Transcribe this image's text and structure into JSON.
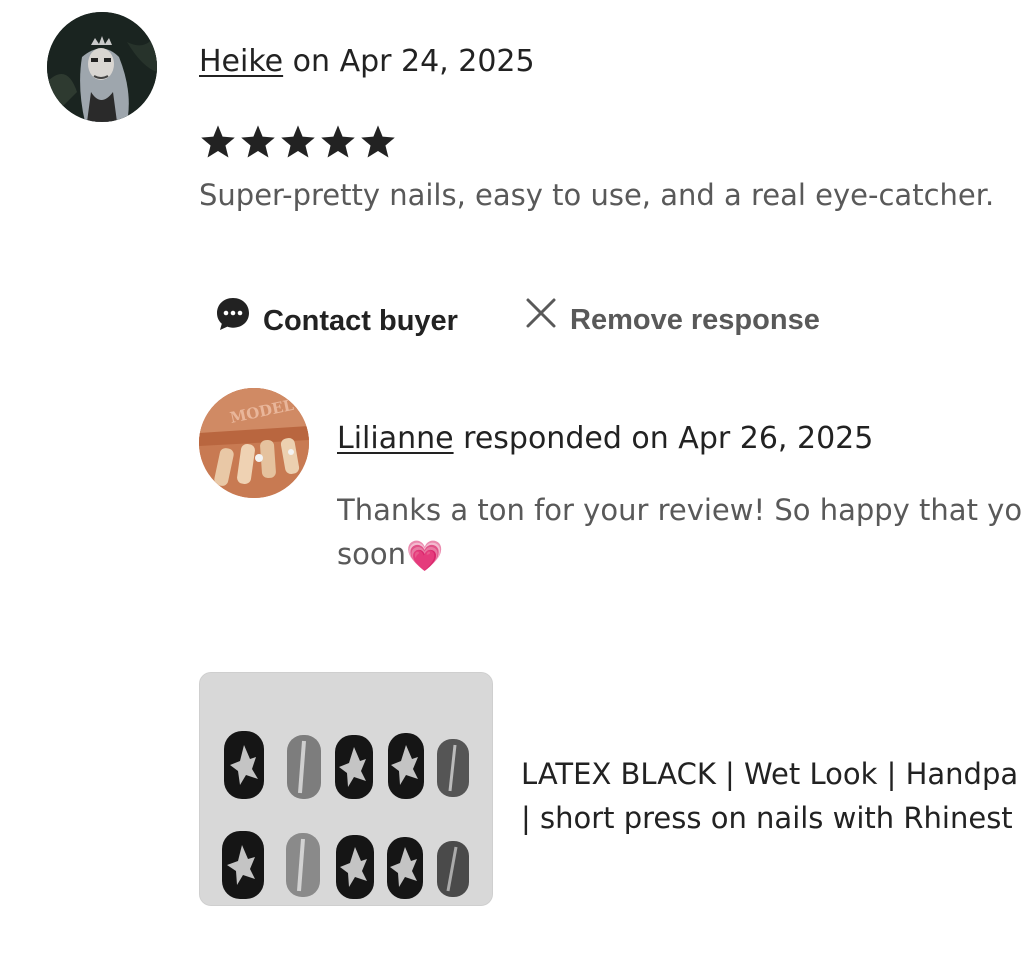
{
  "review": {
    "reviewer_name": "Heike",
    "date_text": "on Apr 24, 2025",
    "rating": 5,
    "text": "Super-pretty nails, easy to use, and a real eye-catcher."
  },
  "actions": {
    "contact_label": "Contact buyer",
    "remove_label": "Remove response"
  },
  "response": {
    "seller_name": "Lilianne",
    "date_text": "responded on Apr 26, 2025",
    "line1": "Thanks a ton for your review! So happy that yo",
    "line2": "soon",
    "emoji": "💗",
    "avatar_text": "MODEL"
  },
  "product": {
    "title_line1": "LATEX BLACK | Wet Look | Handpa",
    "title_line2": "| short press on nails with Rhinest"
  },
  "colors": {
    "text_primary": "#222222",
    "text_secondary": "#595959",
    "star": "#222222"
  }
}
